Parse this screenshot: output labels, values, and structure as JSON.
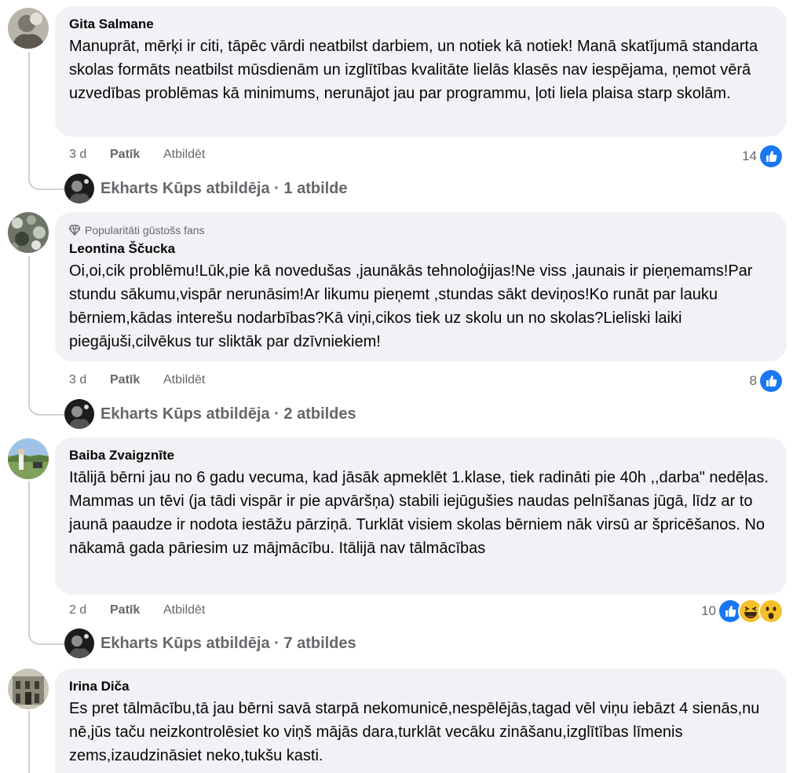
{
  "comments": [
    {
      "author": "Gita Salmane",
      "text": "Manuprāt, mērķi ir citi, tāpēc vārdi neatbilst darbiem, un notiek kā notiek! Manā skatījumā standarta skolas formāts neatbilst mūsdienām un izglītības kvalitāte lielās klasēs nav iespējama, ņemot vērā uzvedības problēmas kā minimums, nerunājot jau par programmu, ļoti liela plaisa starp skolām.",
      "time": "3 d",
      "like_label": "Patīk",
      "reply_label": "Atbildēt",
      "reaction_count": "14",
      "replies_text": "Ekharts Kūps atbildēja · 1 atbilde"
    },
    {
      "badge": "Popularitāti gūstošs fans",
      "author": "Leontina Ščucka",
      "text": "Oi,oi,cik problēmu!Lūk,pie kā novedušas ,jaunākās tehnoloģijas!Ne viss ,jaunais ir pieņemams!Par stundu sākumu,vispār nerunāsim!Ar likumu pieņemt ,stundas sākt deviņos!Ko runāt par lauku bērniem,kādas interešu nodarbības?Kā viņi,cikos tiek uz skolu un no skolas?Lieliski laiki piegājuši,cilvēkus tur sliktāk par dzīvniekiem!",
      "time": "3 d",
      "like_label": "Patīk",
      "reply_label": "Atbildēt",
      "reaction_count": "8",
      "replies_text": "Ekharts Kūps atbildēja · 2 atbildes"
    },
    {
      "author": "Baiba Zvaigznīte",
      "text": "Itālijā bērni jau no 6 gadu vecuma, kad jāsāk apmeklēt 1.klase, tiek radināti pie 40h ,,darba\" nedēļas. Mammas un tēvi (ja tādi vispār ir pie apvāršņa) stabili iejūgušies naudas pelnīšanas jūgā, līdz ar to jaunā paaudze ir nodota iestāžu pārziņā. Turklāt visiem skolas bērniem nāk virsū ar špricēšanos. No nākamā gada pāriesim uz mājmācību. Itālijā nav tālmācības",
      "time": "2 d",
      "like_label": "Patīk",
      "reply_label": "Atbildēt",
      "reaction_count": "10",
      "replies_text": "Ekharts Kūps atbildēja · 7 atbildes"
    },
    {
      "author": "Irina Diča",
      "text": "Es pret tālmācību,tā jau bērni savā starpā nekomunicē,nespēlējās,tagad vēl viņu iebāzt 4 sienās,nu nē,jūs taču neizkontrolēsiet ko viņš mājās dara,turklāt vecāku zināšanu,izglītības līmenis zems,izaudzināsiet neko,tukšu kasti."
    }
  ],
  "colors": {
    "bubble": "#f0f2f5",
    "muted_text": "#65676b",
    "like_blue": "#1877f2",
    "thread_line": "#ced0d4"
  },
  "icons": {
    "like": "thumbs-up-icon",
    "haha": "haha-emoji-icon",
    "wow": "wow-emoji-icon",
    "badge": "diamond-icon"
  }
}
